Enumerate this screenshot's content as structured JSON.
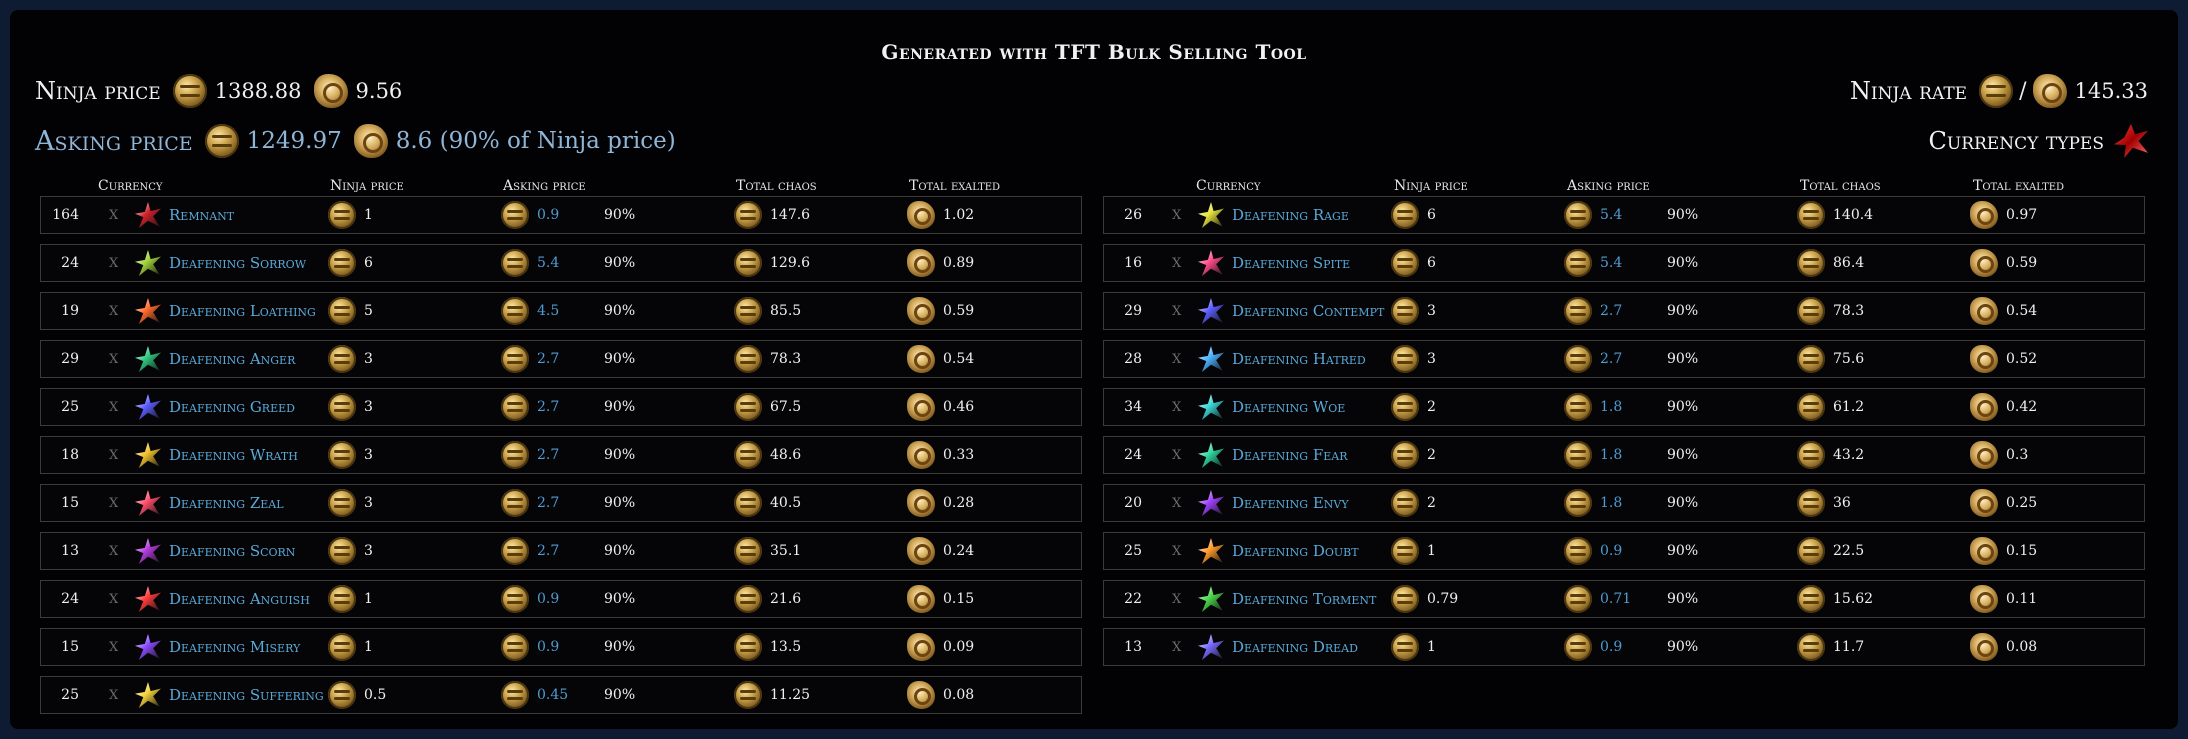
{
  "title": "Generated with TFT Bulk Selling Tool",
  "ninja_price": {
    "label": "Ninja price",
    "chaos": "1388.88",
    "exalted": "9.56"
  },
  "asking_price": {
    "label": "Asking price",
    "chaos": "1249.97",
    "exalted": "8.6 (90% of Ninja price)"
  },
  "ninja_rate": {
    "label": "Ninja rate",
    "separator": "/",
    "value": "145.33"
  },
  "currency_types": {
    "label": "Currency types"
  },
  "columns": {
    "currency": "Currency",
    "ninja_price": "Ninja price",
    "asking_price": "Asking price",
    "total_chaos": "Total chaos",
    "total_exalted": "Total exalted"
  },
  "x_mark": "X",
  "colors": {
    "name": "#5aa9d8",
    "asking": "#4f9bd1",
    "background": "#020204",
    "border": "#3a3a3a"
  },
  "left_items": [
    {
      "qty": "164",
      "name": "Remnant",
      "ninja": "1",
      "ask": "0.9",
      "pct": "90%",
      "chaos": "147.6",
      "exalted": "1.02",
      "color": "#d0202a",
      "show_x": true
    },
    {
      "qty": "24",
      "name": "Deafening Sorrow",
      "ninja": "6",
      "ask": "5.4",
      "pct": "90%",
      "chaos": "129.6",
      "exalted": "0.89",
      "color": "#9fd23a",
      "show_x": true
    },
    {
      "qty": "19",
      "name": "Deafening Loathing",
      "ninja": "5",
      "ask": "4.5",
      "pct": "90%",
      "chaos": "85.5",
      "exalted": "0.59",
      "color": "#ff6a2a",
      "show_x": true
    },
    {
      "qty": "29",
      "name": "Deafening Anger",
      "ninja": "3",
      "ask": "2.7",
      "pct": "90%",
      "chaos": "78.3",
      "exalted": "0.54",
      "color": "#2ec780",
      "show_x": true
    },
    {
      "qty": "25",
      "name": "Deafening Greed",
      "ninja": "3",
      "ask": "2.7",
      "pct": "90%",
      "chaos": "67.5",
      "exalted": "0.46",
      "color": "#5a5cff",
      "show_x": true
    },
    {
      "qty": "18",
      "name": "Deafening Wrath",
      "ninja": "3",
      "ask": "2.7",
      "pct": "90%",
      "chaos": "48.6",
      "exalted": "0.33",
      "color": "#f0c02a",
      "show_x": true
    },
    {
      "qty": "15",
      "name": "Deafening Zeal",
      "ninja": "3",
      "ask": "2.7",
      "pct": "90%",
      "chaos": "40.5",
      "exalted": "0.28",
      "color": "#ff4d6a",
      "show_x": true
    },
    {
      "qty": "13",
      "name": "Deafening Scorn",
      "ninja": "3",
      "ask": "2.7",
      "pct": "90%",
      "chaos": "35.1",
      "exalted": "0.24",
      "color": "#b53ae0",
      "show_x": true
    },
    {
      "qty": "24",
      "name": "Deafening Anguish",
      "ninja": "1",
      "ask": "0.9",
      "pct": "90%",
      "chaos": "21.6",
      "exalted": "0.15",
      "color": "#ff3a3a",
      "show_x": true
    },
    {
      "qty": "15",
      "name": "Deafening Misery",
      "ninja": "1",
      "ask": "0.9",
      "pct": "90%",
      "chaos": "13.5",
      "exalted": "0.09",
      "color": "#8a4aff",
      "show_x": true
    },
    {
      "qty": "25",
      "name": "Deafening Suffering",
      "ninja": "0.5",
      "ask": "0.45",
      "pct": "90%",
      "chaos": "11.25",
      "exalted": "0.08",
      "color": "#f2d23a",
      "show_x": true
    }
  ],
  "right_items": [
    {
      "qty": "26",
      "name": "Deafening Rage",
      "ninja": "6",
      "ask": "5.4",
      "pct": "90%",
      "chaos": "140.4",
      "exalted": "0.97",
      "color": "#e6e23a",
      "show_x": true
    },
    {
      "qty": "16",
      "name": "Deafening Spite",
      "ninja": "6",
      "ask": "5.4",
      "pct": "90%",
      "chaos": "86.4",
      "exalted": "0.59",
      "color": "#ff4a8a",
      "show_x": true
    },
    {
      "qty": "29",
      "name": "Deafening Contempt",
      "ninja": "3",
      "ask": "2.7",
      "pct": "90%",
      "chaos": "78.3",
      "exalted": "0.54",
      "color": "#5a5cff",
      "show_x": true
    },
    {
      "qty": "28",
      "name": "Deafening Hatred",
      "ninja": "3",
      "ask": "2.7",
      "pct": "90%",
      "chaos": "75.6",
      "exalted": "0.52",
      "color": "#4ab0ff",
      "show_x": true
    },
    {
      "qty": "34",
      "name": "Deafening Woe",
      "ninja": "2",
      "ask": "1.8",
      "pct": "90%",
      "chaos": "61.2",
      "exalted": "0.42",
      "color": "#3ad6d6",
      "show_x": true
    },
    {
      "qty": "24",
      "name": "Deafening Fear",
      "ninja": "2",
      "ask": "1.8",
      "pct": "90%",
      "chaos": "43.2",
      "exalted": "0.3",
      "color": "#2ed6a0",
      "show_x": true
    },
    {
      "qty": "20",
      "name": "Deafening Envy",
      "ninja": "2",
      "ask": "1.8",
      "pct": "90%",
      "chaos": "36",
      "exalted": "0.25",
      "color": "#a040ff",
      "show_x": true
    },
    {
      "qty": "25",
      "name": "Deafening Doubt",
      "ninja": "1",
      "ask": "0.9",
      "pct": "90%",
      "chaos": "22.5",
      "exalted": "0.15",
      "color": "#ff9a2a",
      "show_x": true
    },
    {
      "qty": "22",
      "name": "Deafening Torment",
      "ninja": "0.79",
      "ask": "0.71",
      "pct": "90%",
      "chaos": "15.62",
      "exalted": "0.11",
      "color": "#4ad64a",
      "show_x": true
    },
    {
      "qty": "13",
      "name": "Deafening Dread",
      "ninja": "1",
      "ask": "0.9",
      "pct": "90%",
      "chaos": "11.7",
      "exalted": "0.08",
      "color": "#7a6aff",
      "show_x": true
    }
  ]
}
